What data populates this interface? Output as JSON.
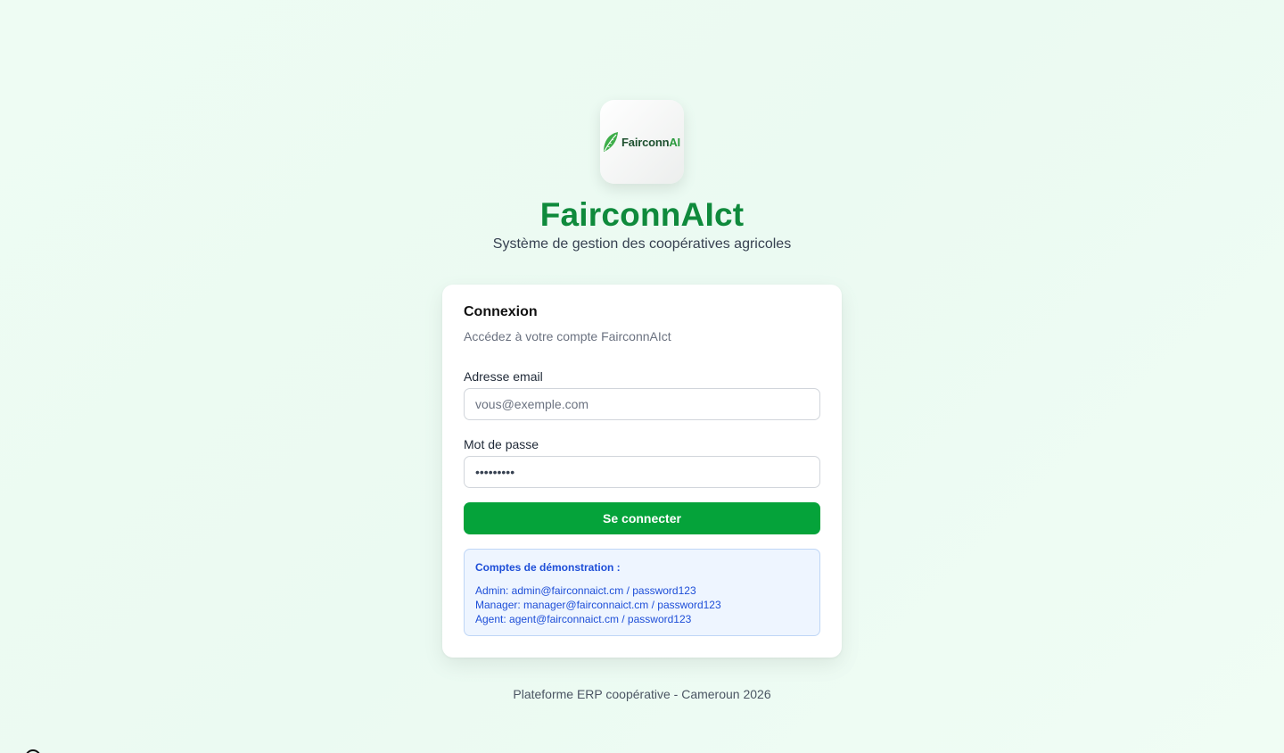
{
  "brand": {
    "logo_text_main": "Fairconn",
    "logo_text_accent": "AI",
    "title": "FairconnAIct",
    "subtitle": "Système de gestion des coopératives agricoles"
  },
  "login": {
    "title": "Connexion",
    "description": "Accédez à votre compte FairconnAIct",
    "email_label": "Adresse email",
    "email_placeholder": "vous@exemple.com",
    "email_value": "",
    "password_label": "Mot de passe",
    "password_value": "•••••••••",
    "submit_label": "Se connecter"
  },
  "demo": {
    "title": "Comptes de démonstration :",
    "accounts": [
      "Admin: admin@fairconnaict.cm / password123",
      "Manager: manager@fairconnaict.cm / password123",
      "Agent: agent@fairconnaict.cm / password123"
    ]
  },
  "footer": {
    "text": "Plateforme ERP coopérative - Cameroun 2026"
  },
  "colors": {
    "brand_green": "#0f8a3c",
    "button_green": "#05a33a",
    "demo_blue": "#1d4ed8",
    "demo_bg": "#eef5ff"
  }
}
